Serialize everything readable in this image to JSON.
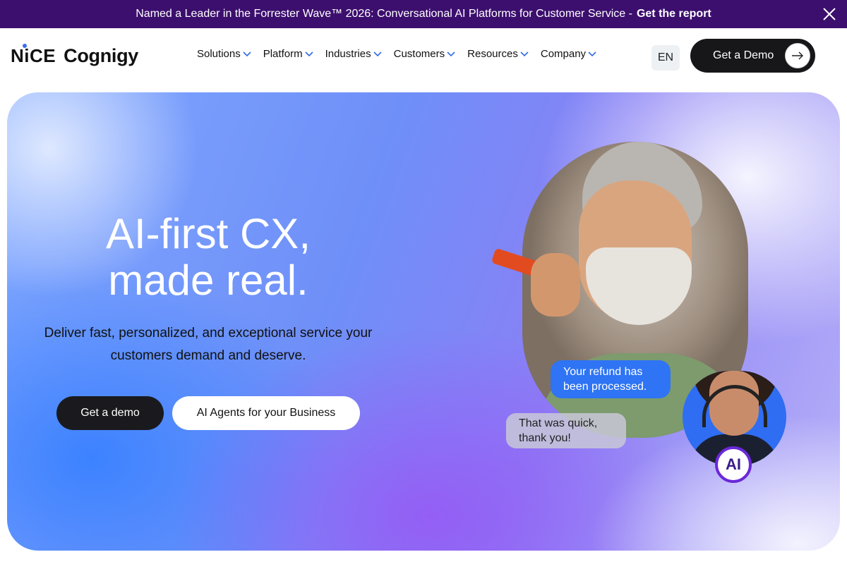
{
  "announcement": {
    "text": "Named a Leader in the Forrester Wave™ 2026: Conversational AI Platforms for Customer Service -",
    "cta": "Get the report"
  },
  "header": {
    "logo_primary": "NiCE",
    "logo_secondary": "Cognigy",
    "nav": [
      "Solutions",
      "Platform",
      "Industries",
      "Customers",
      "Resources",
      "Company"
    ],
    "language": "EN",
    "demo_button": "Get a Demo"
  },
  "hero": {
    "title_line1": "AI-first CX,",
    "title_line2": "made real.",
    "subtitle": "Deliver fast, personalized, and exceptional service your customers demand and deserve.",
    "primary_button": "Get a demo",
    "secondary_button": "AI Agents for your Business",
    "chat_bot_message": "Your refund has been processed.",
    "chat_user_message": "That was quick, thank you!",
    "ai_badge": "AI"
  },
  "colors": {
    "announcement_bg": "#3c0f6e",
    "dark_button": "#17171a",
    "chat_blue": "#2e74f4",
    "ai_ring": "#6a28d8"
  }
}
